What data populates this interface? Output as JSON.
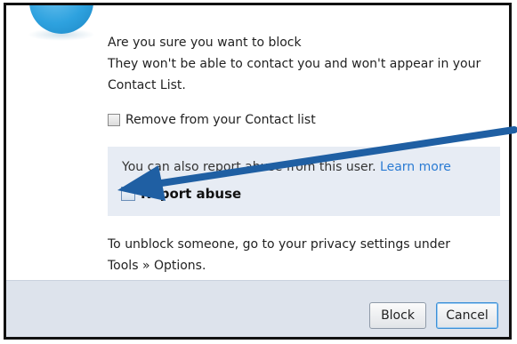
{
  "dialog": {
    "message_line1": "Are you sure you want to block",
    "message_line2": "They won't be able to contact you and won't appear in your",
    "message_line3": "Contact List.",
    "remove_label": "Remove from your Contact list",
    "report_text": "You can also report abuse from this user.",
    "learn_more": "Learn more",
    "report_label": "Report abuse",
    "unblock_line1": "To unblock someone, go to your privacy settings under",
    "unblock_line2": "Tools » Options.",
    "block_button": "Block",
    "cancel_button": "Cancel"
  },
  "colors": {
    "accent": "#2a7bd3",
    "arrow": "#1f5fa3",
    "report_panel": "#e7ecf4",
    "footer": "#dde3ec"
  }
}
